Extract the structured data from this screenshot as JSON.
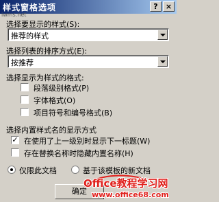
{
  "window": {
    "title": "样式窗格选项",
    "help_button": "?",
    "close_button": "×"
  },
  "show_styles": {
    "label": "选择要显示的样式(S):",
    "value": "推荐的样式"
  },
  "sort_order": {
    "label": "选择列表的排序方式(E):",
    "value": "按推荐"
  },
  "show_as_styles": {
    "label": "选择显示为样式的格式:",
    "options": [
      {
        "label": "段落级别格式(P)",
        "checked": false
      },
      {
        "label": "字体格式(O)",
        "checked": false
      },
      {
        "label": "项目符号和编号格式(B)",
        "checked": false
      }
    ]
  },
  "builtin_names": {
    "label": "选择内置样式名的显示方式",
    "options": [
      {
        "label": "在使用了上一级别时显示下一标题(W)",
        "checked": true
      },
      {
        "label": "存在替换名称时隐藏内置名称(H)",
        "checked": false
      }
    ]
  },
  "scope": {
    "option_doc": "仅限此文档",
    "option_template": "基于该模板的新文档",
    "selected": "option_doc"
  },
  "ok_button": "确定",
  "watermark": {
    "small": "iwms.net",
    "logo_line1": "Office教程学习网",
    "logo_line2": "www.office68.com"
  },
  "colors": {
    "titlebar_start": "#0a246a",
    "titlebar_end": "#a6caf0",
    "dialog_bg": "#d4d0c8",
    "watermark_red": "#e0201c"
  }
}
